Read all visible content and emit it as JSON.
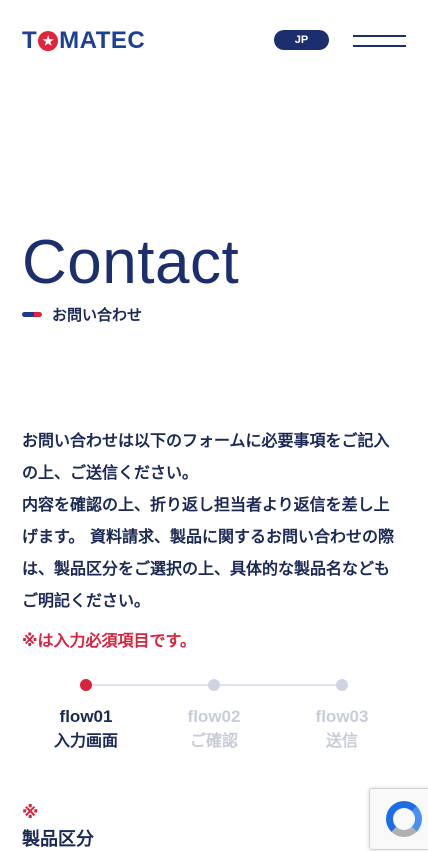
{
  "header": {
    "logo_text_prefix": "T",
    "logo_text_suffix": "MATEC",
    "lang_label": "JP"
  },
  "page": {
    "title": "Contact",
    "subtitle": "お問い合わせ"
  },
  "intro": {
    "lines": [
      "お問い合わせは以下のフォームに必要事項をご記入の上、ご送信ください。",
      "内容を確認の上、折り返し担当者より返信を差し上げます。 資料請求、製品に関するお問い合わせの際は、製品区分をご選択の上、具体的な製品名などもご明記ください。"
    ],
    "required_note": "※は入力必須項目です。"
  },
  "flow": {
    "steps": [
      {
        "num": "flow01",
        "label": "入力画面",
        "active": true
      },
      {
        "num": "flow02",
        "label": "ご確認",
        "active": false
      },
      {
        "num": "flow03",
        "label": "送信",
        "active": false
      }
    ]
  },
  "form": {
    "required_mark": "※",
    "first_field_label": "製品区分"
  },
  "colors": {
    "brand_navy": "#1b2f6e",
    "accent_red": "#d6243e"
  }
}
